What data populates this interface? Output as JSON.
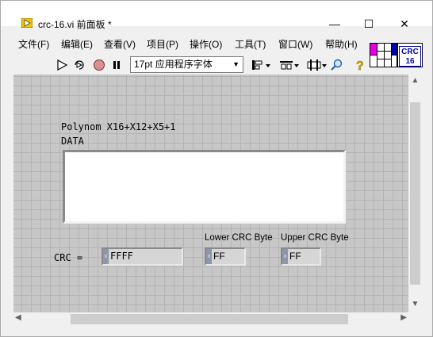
{
  "window": {
    "title": "crc-16.vi 前面板 *",
    "controls": {
      "minimize": "—",
      "maximize": "☐",
      "close": "✕"
    }
  },
  "menu": {
    "items": [
      "文件(F)",
      "编辑(E)",
      "查看(V)",
      "项目(P)",
      "操作(O)",
      "工具(T)",
      "窗口(W)",
      "帮助(H)"
    ]
  },
  "toolbar": {
    "font": "17pt 应用程序字体",
    "icons": [
      "run-arrow-icon",
      "run-continuously-icon",
      "abort-icon",
      "pause-icon",
      "align-icon",
      "distribute-icon",
      "resize-icon",
      "search-icon",
      "help-icon"
    ]
  },
  "vi_icon": {
    "line1": "CRC",
    "line2": "16"
  },
  "panel": {
    "polynom_label": "Polynom X16+X12+X5+1",
    "data_label": "DATA",
    "data_value": "",
    "crc_label": "CRC =",
    "crc_value": "FFFF",
    "lower_label": "Lower CRC Byte",
    "lower_value": "FF",
    "upper_label": "Upper CRC Byte",
    "upper_value": "FF",
    "radix": "x"
  },
  "colors": {
    "panel_bg": "#c7c7c7",
    "grid": "#b4b4b4",
    "vi_icon_text": "#0000b0"
  }
}
